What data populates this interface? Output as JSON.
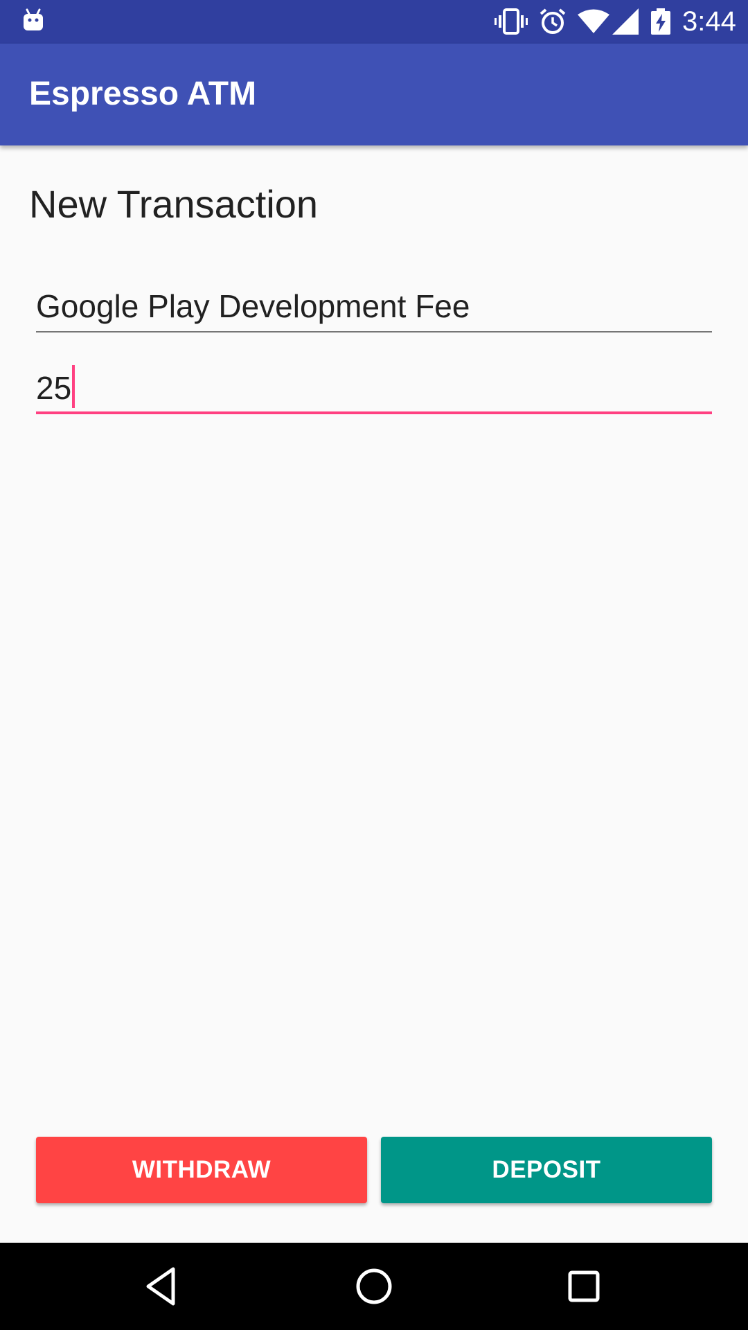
{
  "status_bar": {
    "time": "3:44",
    "icons": [
      "android-notification-icon",
      "vibrate-icon",
      "alarm-icon",
      "wifi-icon",
      "cell-signal-icon",
      "battery-charging-icon"
    ]
  },
  "app_bar": {
    "title": "Espresso ATM"
  },
  "main": {
    "heading": "New Transaction",
    "description_field": {
      "value": "Google Play Development Fee",
      "placeholder": ""
    },
    "amount_field": {
      "value": "25",
      "placeholder": ""
    },
    "withdraw_label": "WITHDRAW",
    "deposit_label": "DEPOSIT"
  },
  "nav_bar": {
    "icons": [
      "back-icon",
      "home-icon",
      "recents-icon"
    ]
  },
  "colors": {
    "status_bar": "#303F9F",
    "primary": "#3F51B5",
    "accent": "#FF4081",
    "withdraw": "#FF4444",
    "deposit": "#009688",
    "background": "#FAFAFA"
  }
}
